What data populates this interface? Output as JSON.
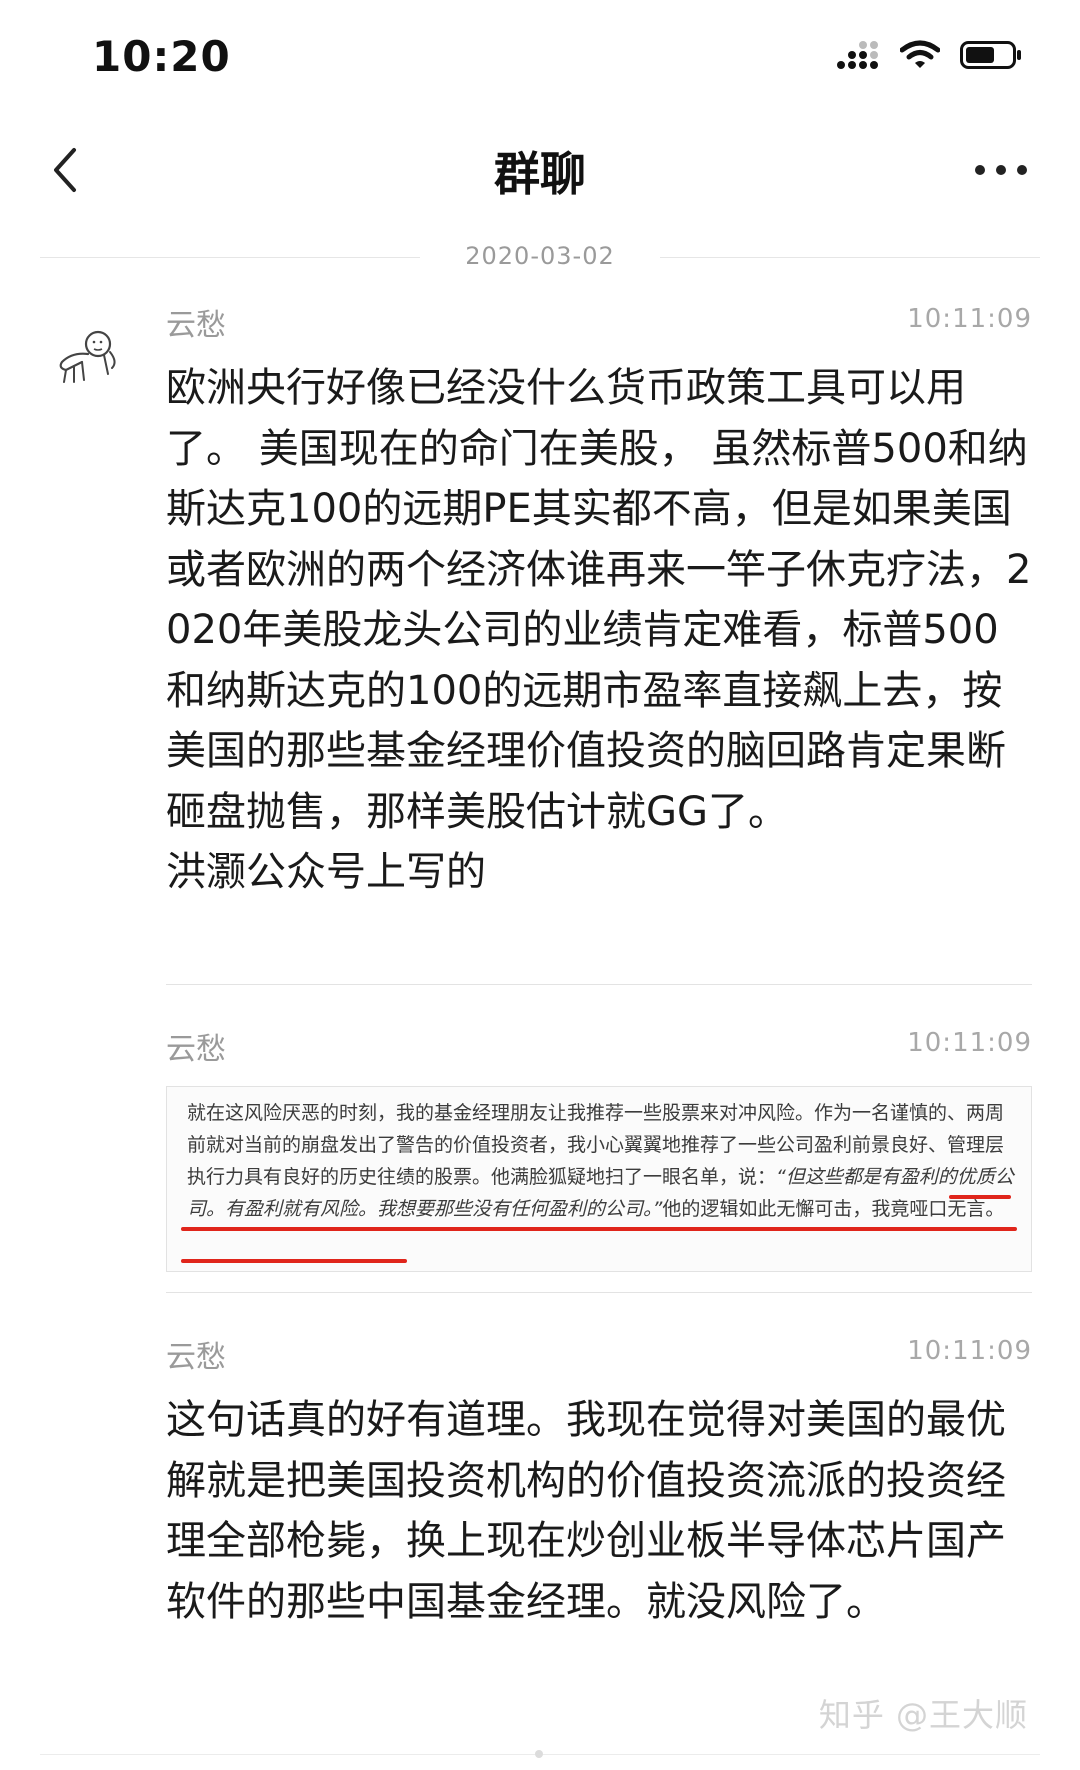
{
  "status_bar": {
    "time": "10:20"
  },
  "nav": {
    "title": "群聊"
  },
  "chat": {
    "date": "2020-03-02",
    "messages": [
      {
        "sender": "云愁",
        "time": "10:11:09",
        "text": "欧洲央行好像已经没什么货币政策工具可以用了。 美国现在的命门在美股， 虽然标普500和纳斯达克100的远期PE其实都不高，但是如果美国或者欧洲的两个经济体谁再来一竿子休克疗法，2020年美股龙头公司的业绩肯定难看，标普500和纳斯达克的100的远期市盈率直接飙上去，按美国的那些基金经理价值投资的脑回路肯定果断砸盘抛售，那样美股估计就GG了。\n洪灏公众号上写的"
      },
      {
        "sender": "云愁",
        "time": "10:11:09",
        "quote_plain": "就在这风险厌恶的时刻，我的基金经理朋友让我推荐一些股票来对冲风险。作为一名谨慎的、两周前就对当前的崩盘发出了警告的价值投资者，我小心翼翼地推荐了一些公司盈利前景良好、管理层执行力具有良好的历史往绩的股票。他满脸狐疑地扫了一眼名单，说：",
        "quote_underlined": "“但这些都是有盈利的优质公司。有盈利就有风险。我想要那些没有任何盈利的公司。”",
        "quote_tail": "他的逻辑如此无懈可击，我竟哑口无言。"
      },
      {
        "sender": "云愁",
        "time": "10:11:09",
        "text": "这句话真的好有道理。我现在觉得对美国的最优解就是把美国投资机构的价值投资流派的投资经理全部枪毙，换上现在炒创业板半导体芯片国产软件的那些中国基金经理。就没风险了。"
      }
    ]
  },
  "watermark": "知乎 @王大顺",
  "colors": {
    "underline_red": "#e0251b",
    "meta_gray": "#9a9a9a"
  }
}
